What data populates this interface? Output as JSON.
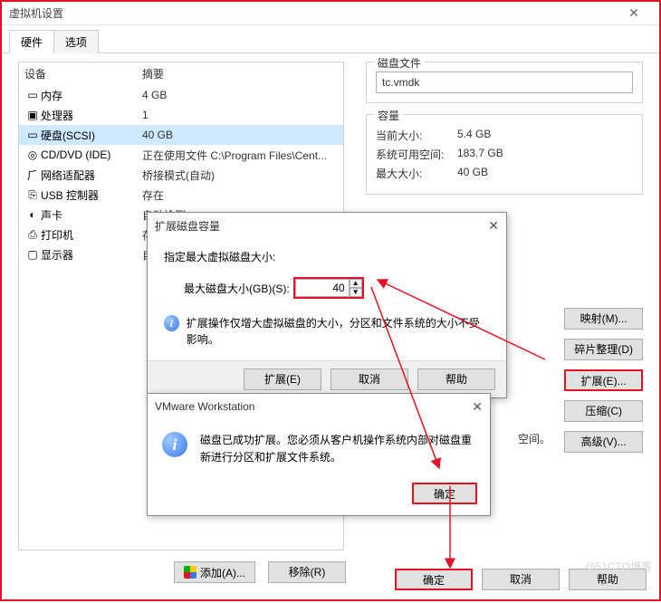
{
  "window": {
    "title": "虚拟机设置",
    "close_glyph": "✕"
  },
  "tabs": {
    "hardware": "硬件",
    "options": "选项"
  },
  "device_header": {
    "col_device": "设备",
    "col_summary": "摘要"
  },
  "devices": [
    {
      "icon": "▬",
      "name": "内存",
      "summary": "4 GB"
    },
    {
      "icon": "▣",
      "name": "处理器",
      "summary": "1"
    },
    {
      "icon": "▭",
      "name": "硬盘(SCSI)",
      "summary": "40 GB",
      "selected": true
    },
    {
      "icon": "◎",
      "name": "CD/DVD (IDE)",
      "summary": "正在使用文件 C:\\Program Files\\Cent..."
    },
    {
      "icon": "�символ",
      "name_override": "网络适配器",
      "icon_glyph": "🝆",
      "name2": "网络适配器",
      "summary": "桥接模式(自动)"
    },
    {
      "icon": "⎘",
      "name": "USB 控制器",
      "summary": "存在"
    },
    {
      "icon": "🔊",
      "name": "声卡",
      "summary": "自动检测"
    },
    {
      "icon": "🖶",
      "name": "打印机",
      "summary": "存在"
    },
    {
      "icon": "🖵",
      "name": "显示器",
      "summary": "自"
    }
  ],
  "disk_file_group": {
    "caption": "磁盘文件",
    "value": "tc.vmdk"
  },
  "capacity_group": {
    "caption": "容量",
    "current_label": "当前大小:",
    "current_value": "5.4 GB",
    "free_label": "系统可用空间:",
    "free_value": "183.7 GB",
    "max_label": "最大大小:",
    "max_value": "40 GB"
  },
  "side_buttons": {
    "map": "映射(M)...",
    "defrag": "碎片整理(D)",
    "expand": "扩展(E)...",
    "compress": "压缩(C)",
    "advanced": "高级(V)..."
  },
  "extra_space_label": "空间。",
  "add_remove": {
    "add": "添加(A)...",
    "remove": "移除(R)"
  },
  "footer": {
    "ok": "确定",
    "cancel": "取消",
    "help": "帮助"
  },
  "expand_dialog": {
    "title": "扩展磁盘容量",
    "close_glyph": "✕",
    "prompt": "指定最大虚拟磁盘大小:",
    "size_label": "最大磁盘大小(GB)(S):",
    "size_value": "40",
    "info_text": "扩展操作仅增大虚拟磁盘的大小，分区和文件系统的大小不受影响。",
    "btn_expand": "扩展(E)",
    "btn_cancel": "取消",
    "btn_help": "帮助"
  },
  "confirm_dialog": {
    "title": "VMware Workstation",
    "close_glyph": "✕",
    "message": "磁盘已成功扩展。您必须从客户机操作系统内部对磁盘重新进行分区和扩展文件系统。",
    "ok": "确定"
  },
  "watermark": "@51CTO博客"
}
